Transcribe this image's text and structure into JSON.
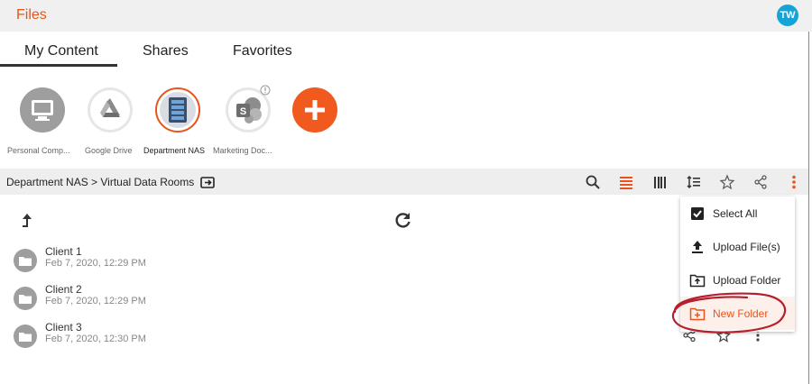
{
  "header": {
    "title": "Files",
    "avatar_initials": "TW",
    "accent": "#e8541c",
    "avatar_color": "#16a4d8"
  },
  "tabs": [
    {
      "label": "My Content",
      "active": true
    },
    {
      "label": "Shares",
      "active": false
    },
    {
      "label": "Favorites",
      "active": false
    }
  ],
  "sources": [
    {
      "label": "Personal Comp...",
      "icon": "monitor-icon"
    },
    {
      "label": "Google Drive",
      "icon": "google-drive-icon"
    },
    {
      "label": "Department NAS",
      "icon": "nas-server-icon",
      "active": true
    },
    {
      "label": "Marketing Doc...",
      "icon": "sharepoint-icon"
    }
  ],
  "add_source_icon": "plus-icon",
  "breadcrumb": {
    "text": "Department NAS > Virtual Data Rooms"
  },
  "toolbar_icons": [
    "search-icon",
    "list-view-icon",
    "grid-view-icon",
    "sort-icon",
    "star-icon",
    "share-icon",
    "more-vert-icon"
  ],
  "files": [
    {
      "name": "Client 1",
      "date": "Feb 7, 2020, 12:29 PM"
    },
    {
      "name": "Client 2",
      "date": "Feb 7, 2020, 12:29 PM"
    },
    {
      "name": "Client 3",
      "date": "Feb 7, 2020, 12:30 PM"
    }
  ],
  "menu": {
    "items": [
      {
        "label": "Select All",
        "icon": "checkbox-icon"
      },
      {
        "label": "Upload File(s)",
        "icon": "upload-icon"
      },
      {
        "label": "Upload Folder",
        "icon": "upload-folder-icon"
      },
      {
        "label": "New Folder",
        "icon": "new-folder-icon",
        "highlighted": true
      }
    ]
  }
}
